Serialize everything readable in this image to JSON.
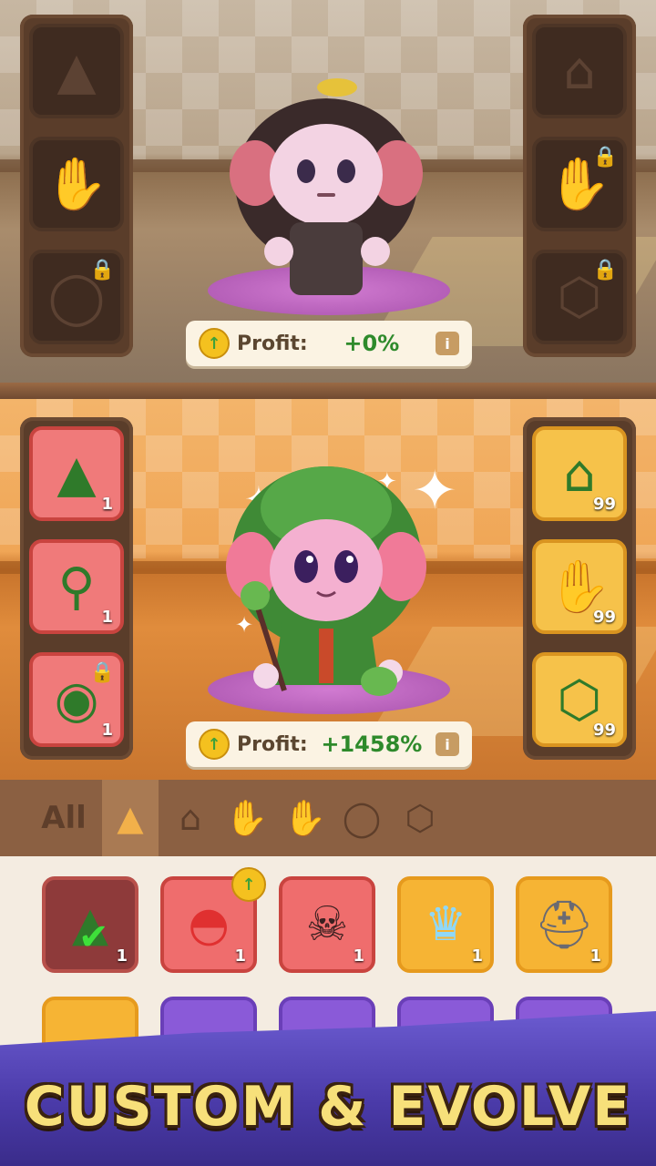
{
  "top_panel": {
    "profit_label": "Profit:",
    "profit_value": "+0%",
    "info_label": "i",
    "left_slots": [
      {
        "icon": "witch-hat-icon",
        "locked": false
      },
      {
        "icon": "glove-icon",
        "locked": false
      },
      {
        "icon": "ring-icon",
        "locked": true
      }
    ],
    "right_slots": [
      {
        "icon": "cape-icon",
        "locked": false
      },
      {
        "icon": "glove-icon",
        "locked": true
      },
      {
        "icon": "necklace-icon",
        "locked": true
      }
    ]
  },
  "bottom_panel": {
    "profit_label": "Profit:",
    "profit_value": "+1458%",
    "info_label": "i",
    "left_slots": [
      {
        "icon": "leaf-hat-icon",
        "count": "1"
      },
      {
        "icon": "leaf-staff-icon",
        "count": "1"
      },
      {
        "icon": "leaf-ring-icon",
        "count": "1",
        "locked": true
      }
    ],
    "right_slots": [
      {
        "icon": "leaf-cape-icon",
        "count": "99"
      },
      {
        "icon": "leaf-glove-icon",
        "count": "99"
      },
      {
        "icon": "leaf-necklace-icon",
        "count": "99"
      }
    ]
  },
  "tabs": [
    {
      "label": "All",
      "icon": ""
    },
    {
      "label": "",
      "icon": "hat-icon",
      "selected": true
    },
    {
      "label": "",
      "icon": "cape-icon"
    },
    {
      "label": "",
      "icon": "glove-icon"
    },
    {
      "label": "",
      "icon": "hand-icon"
    },
    {
      "label": "",
      "icon": "ring-icon"
    },
    {
      "label": "",
      "icon": "necklace-icon"
    }
  ],
  "inventory": {
    "row1": [
      {
        "icon": "leaf-hat-equipped-icon",
        "count": "1"
      },
      {
        "icon": "mushroom-hat-icon",
        "count": "1"
      },
      {
        "icon": "pirate-hat-icon",
        "count": "1"
      },
      {
        "icon": "ice-crown-icon",
        "count": "1"
      },
      {
        "icon": "knight-helmet-icon",
        "count": "1"
      }
    ]
  },
  "banner": {
    "text": "CUSTOM & EVOLVE"
  },
  "colors": {
    "profit_green": "#2e8a2b",
    "banner_yellow": "#f7e07a",
    "banner_purple": "#4a3aa8"
  }
}
